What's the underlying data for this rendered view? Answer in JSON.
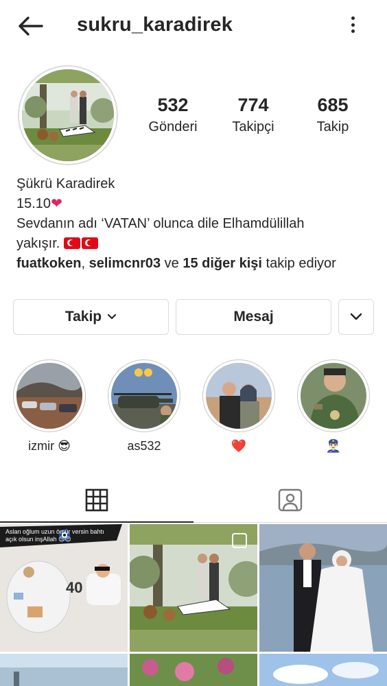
{
  "header": {
    "username": "sukru_karadirek"
  },
  "stats": [
    {
      "value": "532",
      "label": "Gönderi"
    },
    {
      "value": "774",
      "label": "Takipçi"
    },
    {
      "value": "685",
      "label": "Takip"
    }
  ],
  "bio": {
    "full_name": "Şükrü Karadirek",
    "line1": "15.10",
    "line2": "Sevdanın adı ‘VATAN’ olunca dile Elhamdülillah",
    "line3": "yakışır.",
    "followed_by_1": "fuatkoken",
    "sep": ", ",
    "followed_by_2": "selimcnr03",
    "and": " ve ",
    "others": "15 diğer kişi",
    "suffix": " takip ediyor"
  },
  "actions": {
    "follow_label": "Takip",
    "message_label": "Mesaj"
  },
  "highlights": [
    {
      "label": "izmir 😎"
    },
    {
      "label": "as532"
    },
    {
      "label": "❤️"
    },
    {
      "label": "👮🏻‍♂️"
    }
  ],
  "grid": {
    "post1_caption": "Aslan oğlum uzun ömür versin bahtı açık olsun inşAllah 😊😊",
    "post1_number": "40"
  },
  "colors": {
    "text": "#262626",
    "border": "#dbdbdb",
    "heart": "#e0245e",
    "flag": "#e30a17"
  }
}
